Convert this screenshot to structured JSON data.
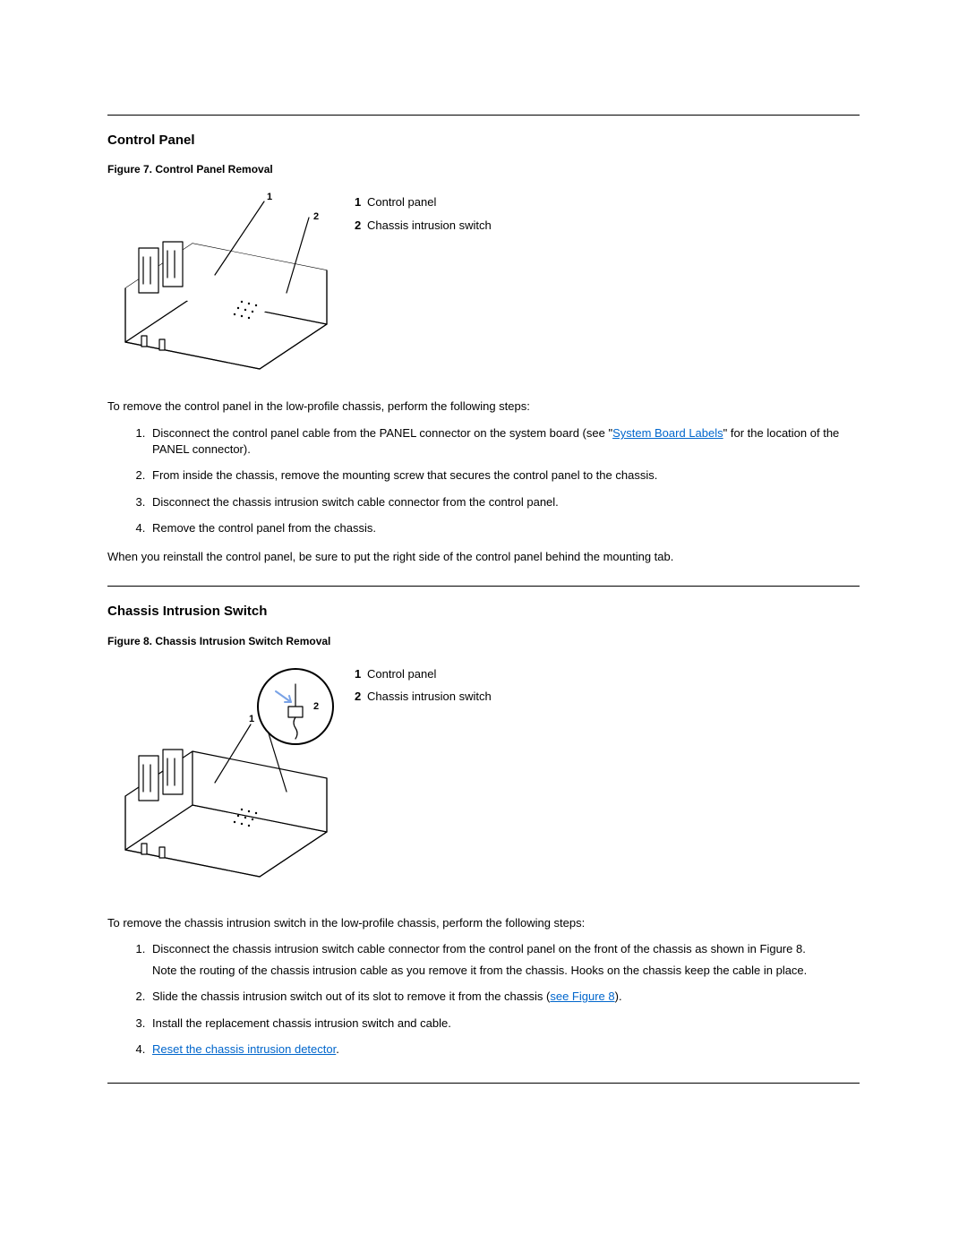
{
  "section1": {
    "heading": "Control Panel",
    "figureCaption": "Figure 7. Control Panel Removal",
    "callouts": {
      "c1": "1",
      "c2": "2"
    },
    "legend": [
      {
        "num": "1",
        "text": "Control panel"
      },
      {
        "num": "2",
        "text": "Chassis intrusion switch"
      }
    ],
    "intro": "To remove the control panel in the low-profile chassis, perform the following steps:",
    "steps": {
      "s1_a": "Disconnect the control panel cable from the PANEL connector on the system board (see \"",
      "s1_link": "System Board Labels",
      "s1_b": "\" for the location of the PANEL connector).",
      "s2": "From inside the chassis, remove the mounting screw that secures the control panel to the chassis.",
      "s3": "Disconnect the chassis intrusion switch cable connector from the control panel.",
      "s4": "Remove the control panel from the chassis."
    },
    "note": "When you reinstall the control panel, be sure to put the right side of the control panel behind the mounting tab."
  },
  "section2": {
    "heading": "Chassis Intrusion Switch",
    "figureCaption": "Figure 8. Chassis Intrusion Switch Removal",
    "callouts": {
      "c1": "1",
      "c2": "2"
    },
    "legend": [
      {
        "num": "1",
        "text": "Control panel"
      },
      {
        "num": "2",
        "text": "Chassis intrusion switch"
      }
    ],
    "intro": "To remove the chassis intrusion switch in the low-profile chassis, perform the following steps:",
    "steps": {
      "s1": "Disconnect the chassis intrusion switch cable connector from the control panel on the front of the chassis as shown in Figure 8.",
      "s1_sub": "Note the routing of the chassis intrusion cable as you remove it from the chassis. Hooks on the chassis keep the cable in place.",
      "s2_a": "Slide the chassis intrusion switch out of its slot to remove it from the chassis (",
      "s2_link": "see Figure 8",
      "s2_b": ").",
      "s3": "Install the replacement chassis intrusion switch and cable.",
      "s4_link": "Reset the chassis intrusion detector",
      "s4_b": "."
    }
  }
}
